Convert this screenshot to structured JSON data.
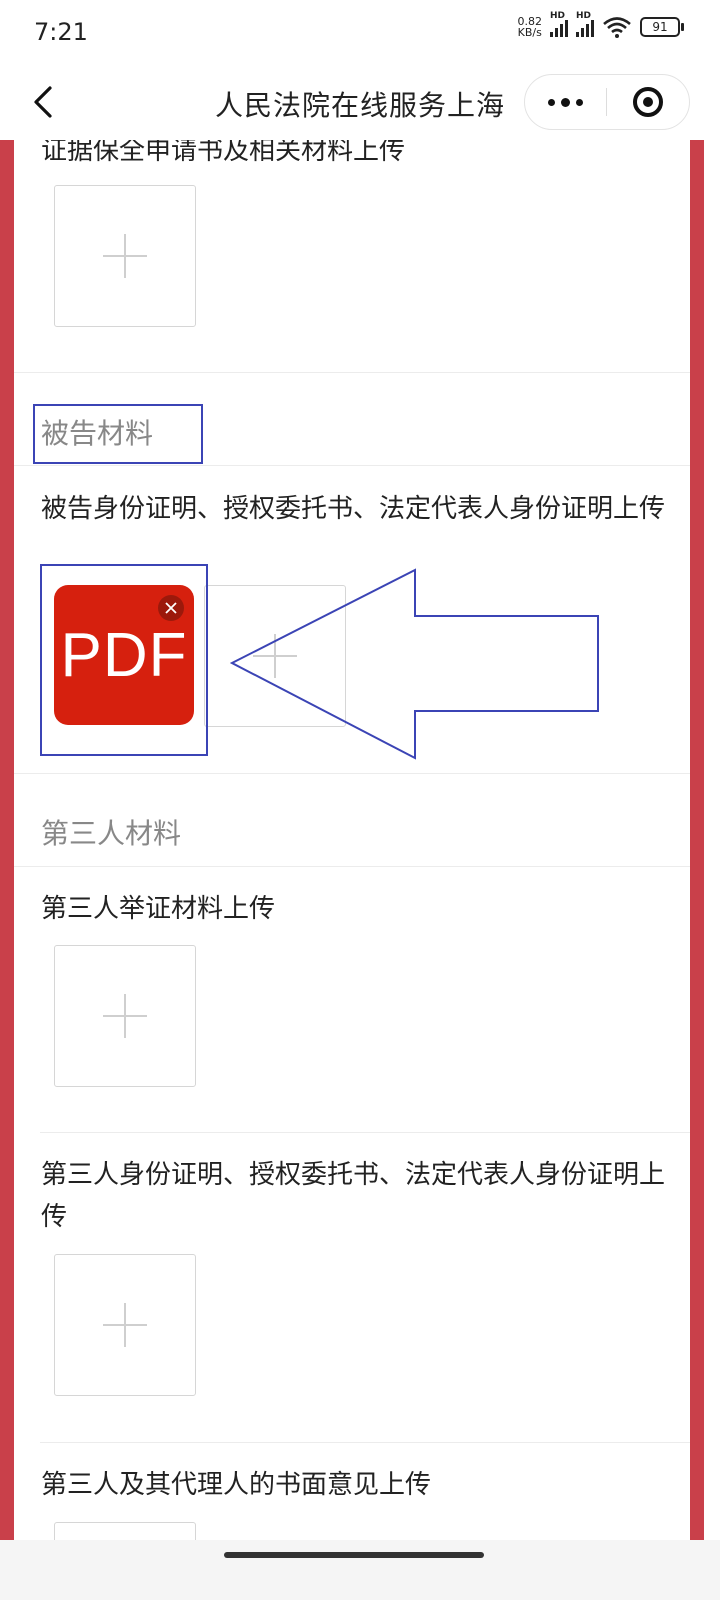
{
  "status_bar": {
    "time": "7:21",
    "net_speed_value": "0.82",
    "net_speed_unit": "KB/s",
    "signal_label": "HD",
    "battery": "91"
  },
  "nav": {
    "title": "人民法院在线服务上海"
  },
  "sections": {
    "plaintiff_partial": {
      "item_label": "证据保全申请书及相关材料上传"
    },
    "defendant": {
      "title": "被告材料",
      "item_label": "被告身份证明、授权委托书、法定代表人身份证明上传",
      "attachment_label": "PDF"
    },
    "third_party": {
      "title": "第三人材料",
      "items": [
        {
          "label": "第三人举证材料上传"
        },
        {
          "label": "第三人身份证明、授权委托书、法定代表人身份证明上传"
        },
        {
          "label": "第三人及其代理人的书面意见上传"
        }
      ]
    }
  },
  "colors": {
    "side_border": "#c9404a",
    "pdf_tile": "#d6200e",
    "annotation": "#3b44b5"
  }
}
